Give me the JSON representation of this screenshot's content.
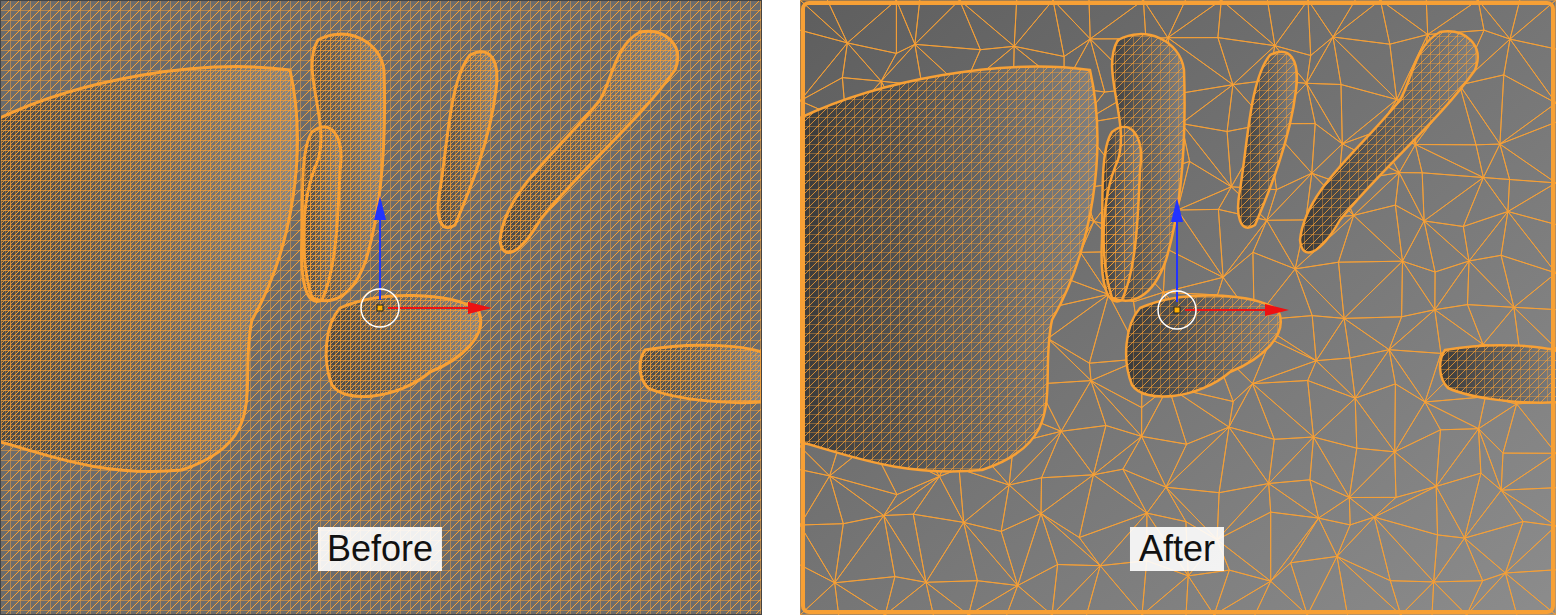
{
  "panels": [
    {
      "label": "Before",
      "kind": "grid"
    },
    {
      "label": "After",
      "kind": "triangulated"
    }
  ]
}
